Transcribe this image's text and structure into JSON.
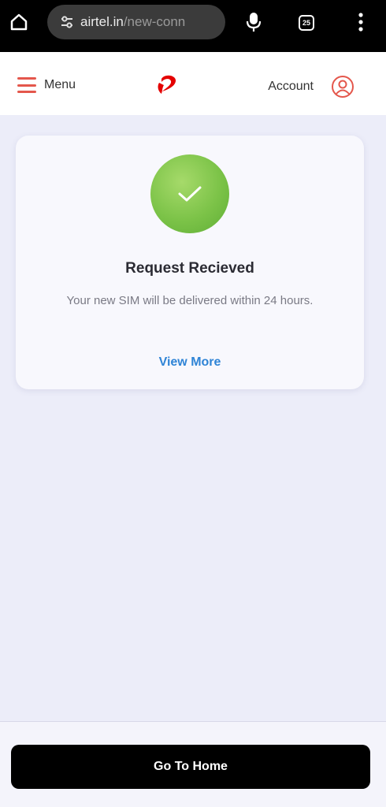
{
  "browser": {
    "url_host": "airtel.in",
    "url_path": "/new-conn",
    "tab_count": "25"
  },
  "header": {
    "menu_label": "Menu",
    "account_label": "Account"
  },
  "confirmation": {
    "title": "Request Recieved",
    "message": "Your new SIM will be delivered within 24 hours.",
    "link_label": "View More"
  },
  "footer": {
    "button_label": "Go To Home"
  },
  "colors": {
    "brand_red": "#e40000",
    "success_green": "#7cc348",
    "link_blue": "#2f84d6",
    "page_background": "#ecedf9"
  }
}
